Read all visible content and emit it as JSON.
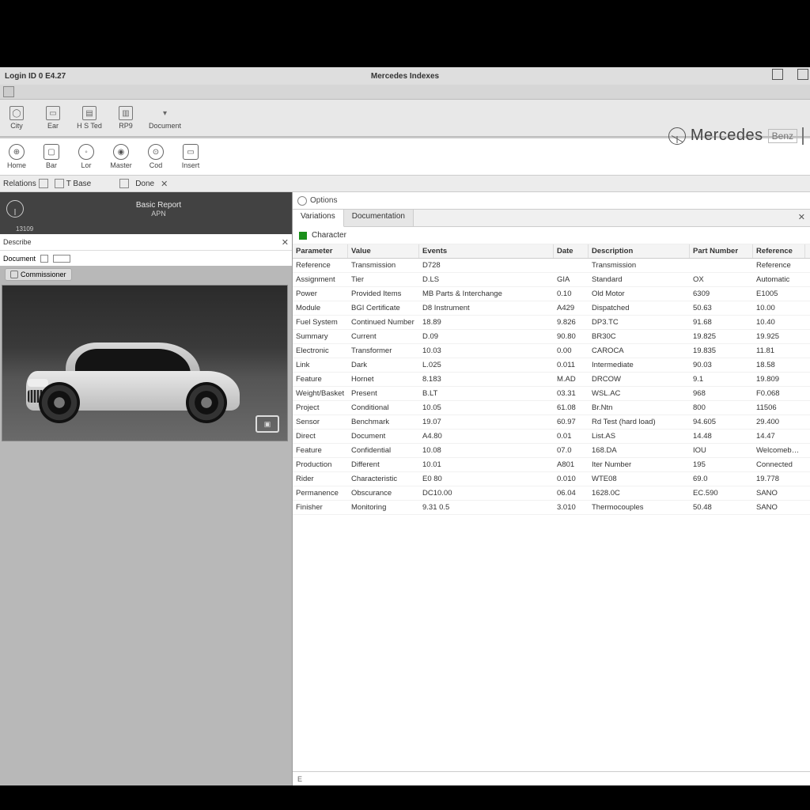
{
  "window": {
    "left_caption": "Login ID 0 E4.27",
    "center_caption": "Mercedes Indexes"
  },
  "toolbar1": {
    "items": [
      {
        "label": "City",
        "glyph": "◯"
      },
      {
        "label": "Ear",
        "glyph": "▭"
      },
      {
        "label": "H S Ted",
        "glyph": "▤"
      },
      {
        "label": "RP9",
        "glyph": "▥"
      },
      {
        "label": "Document",
        "glyph": "▾"
      }
    ]
  },
  "toolbar2": {
    "items": [
      {
        "label": "Home",
        "glyph": "⊕",
        "shape": "circ"
      },
      {
        "label": "Bar",
        "glyph": "▢",
        "shape": "sq"
      },
      {
        "label": "Lor",
        "glyph": "◦",
        "shape": "circ"
      },
      {
        "label": "Master",
        "glyph": "◉",
        "shape": "circ"
      },
      {
        "label": "Cod",
        "glyph": "⊙",
        "shape": "circ"
      },
      {
        "label": "Insert",
        "glyph": "▭",
        "shape": "sq"
      }
    ]
  },
  "brand": {
    "name": "Mercedes",
    "sub": "Benz"
  },
  "filterstrip": {
    "a_label": "Relations",
    "b_label": "T Base",
    "c_label": "Done"
  },
  "leftpane": {
    "header_num": "13109",
    "header_t1": "Basic Report",
    "header_t2": "APN",
    "sub_a": "Describe",
    "sub_b": "Document",
    "pill": "Commissioner"
  },
  "rightpane": {
    "head_label": "Options",
    "tab1": "Variations",
    "tab2": "Documentation",
    "sub_label": "Character",
    "status": "E"
  },
  "grid": {
    "columns": [
      "Parameter",
      "Value",
      "Events",
      "Date",
      "Description",
      "Part Number",
      "Reference"
    ],
    "rows": [
      {
        "c0": "Reference",
        "c1": "Transmission",
        "c2": "D728",
        "c3": "",
        "c4": "Transmission",
        "c5": "",
        "c6": "Reference"
      },
      {
        "c0": "Assignment",
        "c1": "Tier",
        "c2": "D.LS",
        "c3": "GIA",
        "c4": "Standard",
        "c5": "OX",
        "c6": "Automatic"
      },
      {
        "c0": "Power",
        "c1": "Provided Items",
        "c2": "MB Parts & Interchange",
        "c3": "0.10",
        "c4": "Old Motor",
        "c5": "6309",
        "c6": "E1005"
      },
      {
        "c0": "Module",
        "c1": "BGI Certificate",
        "c2": "D8 Instrument",
        "c3": "A429",
        "c4": "Dispatched",
        "c5": "50.63",
        "c6": "10.00"
      },
      {
        "c0": "Fuel System",
        "c1": "Continued Number",
        "c2": "18.89",
        "c3": "9.826",
        "c4": "DP3.TC",
        "c5": "91.68",
        "c6": "10.40"
      },
      {
        "c0": "Summary",
        "c1": "Current",
        "c2": "D.09",
        "c3": "90.80",
        "c4": "BR30C",
        "c5": "19.825",
        "c6": "19.925"
      },
      {
        "c0": "Electronic",
        "c1": "Transformer",
        "c2": "10.03",
        "c3": "0.00",
        "c4": "CAROCA",
        "c5": "19.835",
        "c6": "11.81"
      },
      {
        "c0": "Link",
        "c1": "Dark",
        "c2": "L.025",
        "c3": "0.011",
        "c4": "Intermediate",
        "c5": "90.03",
        "c6": "18.58"
      },
      {
        "c0": "Feature",
        "c1": "Hornet",
        "c2": "8.183",
        "c3": "M.AD",
        "c4": "DRCOW",
        "c5": "9.1",
        "c6": "19.809"
      },
      {
        "c0": "Weight/Basket",
        "c1": "Present",
        "c2": "B.LT",
        "c3": "03.31",
        "c4": "WSL.AC",
        "c5": "968",
        "c6": "F0.068"
      },
      {
        "c0": "Project",
        "c1": "Conditional",
        "c2": "10.05",
        "c3": "61.08",
        "c4": "Br.Ntn",
        "c5": "800",
        "c6": "11506"
      },
      {
        "c0": "Sensor",
        "c1": "Benchmark",
        "c2": "19.07",
        "c3": "60.97",
        "c4": "Rd Test (hard load)",
        "c5": "94.605",
        "c6": "29.400"
      },
      {
        "c0": "Direct",
        "c1": "Document",
        "c2": "A4.80",
        "c3": "0.01",
        "c4": "List.AS",
        "c5": "14.48",
        "c6": "14.47"
      },
      {
        "c0": "Feature",
        "c1": "Confidential",
        "c2": "10.08",
        "c3": "07.0",
        "c4": "168.DA",
        "c5": "IOU",
        "c6": "Welcomeback"
      },
      {
        "c0": "Production",
        "c1": "Different",
        "c2": "10.01",
        "c3": "A801",
        "c4": "Iter Number",
        "c5": "195",
        "c6": "Connected"
      },
      {
        "c0": "Rider",
        "c1": "Characteristic",
        "c2": "E0 80",
        "c3": "0.010",
        "c4": "WTE08",
        "c5": "69.0",
        "c6": "19.778"
      },
      {
        "c0": "Permanence",
        "c1": "Obscurance",
        "c2": "DC10.00",
        "c3": "06.04",
        "c4": "1628.0C",
        "c5": "EC.590",
        "c6": "SANO"
      },
      {
        "c0": "Finisher",
        "c1": "Monitoring",
        "c2": "9.31 0.5",
        "c3": "3.010",
        "c4": "Thermocouples",
        "c5": "50.48",
        "c6": "SANO"
      }
    ]
  }
}
